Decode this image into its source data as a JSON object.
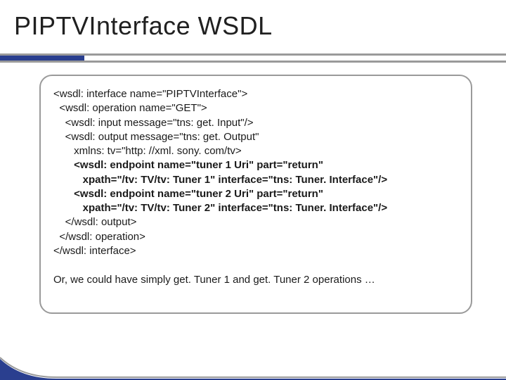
{
  "title": "PIPTVInterface WSDL",
  "code": {
    "l1": "<wsdl: interface name=\"PIPTVInterface\">",
    "l2": "  <wsdl: operation name=\"GET\">",
    "l3": "    <wsdl: input message=\"tns: get. Input\"/>",
    "l4": "    <wsdl: output message=\"tns: get. Output\"",
    "l5": "       xmlns: tv=\"http: //xml. sony. com/tv>",
    "l6": "       <wsdl: endpoint name=\"tuner 1 Uri\" part=\"return\"",
    "l7": "          xpath=\"/tv: TV/tv: Tuner 1\" interface=\"tns: Tuner. Interface\"/>",
    "l8": "       <wsdl: endpoint name=\"tuner 2 Uri\" part=\"return\"",
    "l9": "          xpath=\"/tv: TV/tv: Tuner 2\" interface=\"tns: Tuner. Interface\"/>",
    "l10": "    </wsdl: output>",
    "l11": "  </wsdl: operation>",
    "l12": "</wsdl: interface>"
  },
  "footer": "Or, we could have simply get. Tuner 1 and get. Tuner 2 operations …"
}
